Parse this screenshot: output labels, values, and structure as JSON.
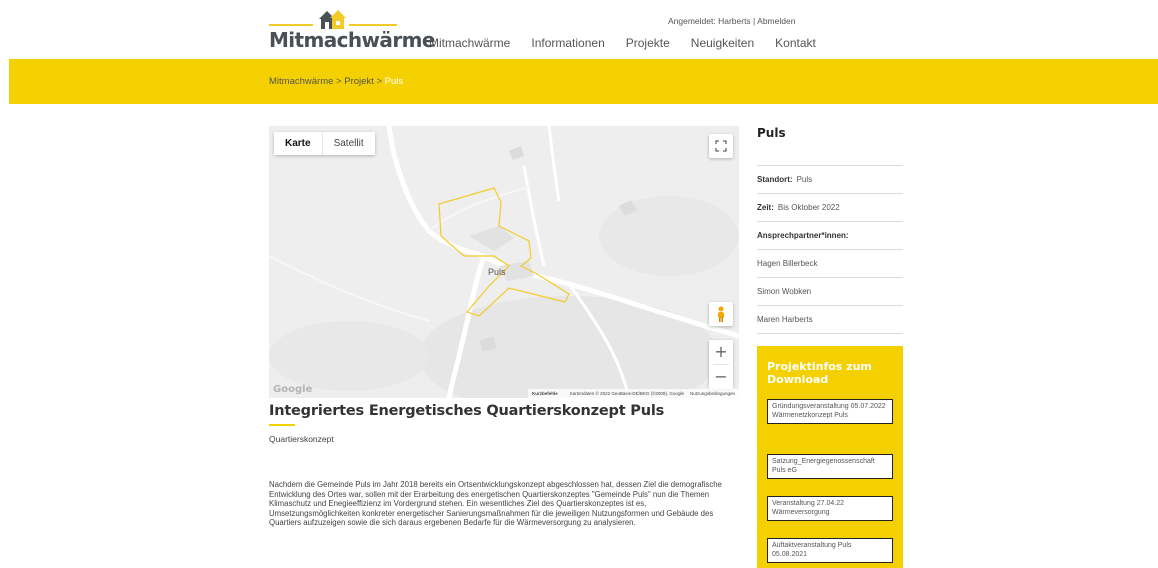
{
  "header": {
    "logo_text": "Mitmachwärme",
    "login_prefix": "Angemeldet: Harberts",
    "login_separator": " | ",
    "logout_label": "Abmelden",
    "nav": [
      "Mitmachwärme",
      "Informationen",
      "Projekte",
      "Neuigkeiten",
      "Kontakt"
    ]
  },
  "breadcrumb": {
    "part1": "Mitmachwärme",
    "sep": " > ",
    "part2": "Projekt",
    "current": "Puls"
  },
  "map": {
    "type_map_label": "Karte",
    "type_satellite_label": "Satellit",
    "place_label": "Puls",
    "google_logo": "Google",
    "shortcuts_label": "Kurzbefehle",
    "map_data_label": "Kartendaten © 2022 GeoBasis-DE/BKG (©2009), Google",
    "terms_label": "Nutzungsbedingungen",
    "zoom_in_label": "+",
    "zoom_out_label": "−",
    "outline_color": "#f2cb2a"
  },
  "article": {
    "title": "Integriertes Energetisches Quartierskonzept Puls",
    "subtitle": "Quartierskonzept",
    "body": "Nachdem die Gemeinde Puls im Jahr 2018 bereits ein Ortsentwicklungskonzept abgeschlossen hat, dessen Ziel die demografische Entwicklung des Ortes war, sollen mit der Erarbeitung des energetischen Quartierskonzeptes \"Gemeinde Puls\" nun die Themen Klimaschutz und Enegieeffizienz im Vordergrund stehen. Ein wesentliches Ziel des Quartierskonzeptes ist es, Umsetzungsmöglichkeiten konkreter energetischer Sanierungsmaßnahmen für die jeweiligen Nutzungsformen und Gebäude des Quartiers aufzuzeigen sowie die sich daraus ergebenen Bedarfe für die Wärmeversorgung zu analysieren."
  },
  "sidebar": {
    "title": "Puls",
    "location_label": "Standort:",
    "location_value": "Puls",
    "time_label": "Zeit:",
    "time_value": "Bis Oktober 2022",
    "contacts_label": "Ansprechpartner*innen:",
    "contacts": [
      "Hagen Billerbeck",
      "Simon Wobken",
      "Maren Harberts"
    ],
    "downloads_title": "Projektinfos zum Download",
    "downloads": [
      "Gründungsveranstaltung 05.07.2022 Wärmenetzkonzept Puls",
      "Satzung_Energiegenossenschaft Puls eG",
      "Veranstaltung 27.04.22 Wärmeversorgung",
      "Auftaktveranstaltung Puls 05.08.2021"
    ]
  },
  "colors": {
    "brand_yellow": "#f5d000",
    "text": "#333333"
  }
}
